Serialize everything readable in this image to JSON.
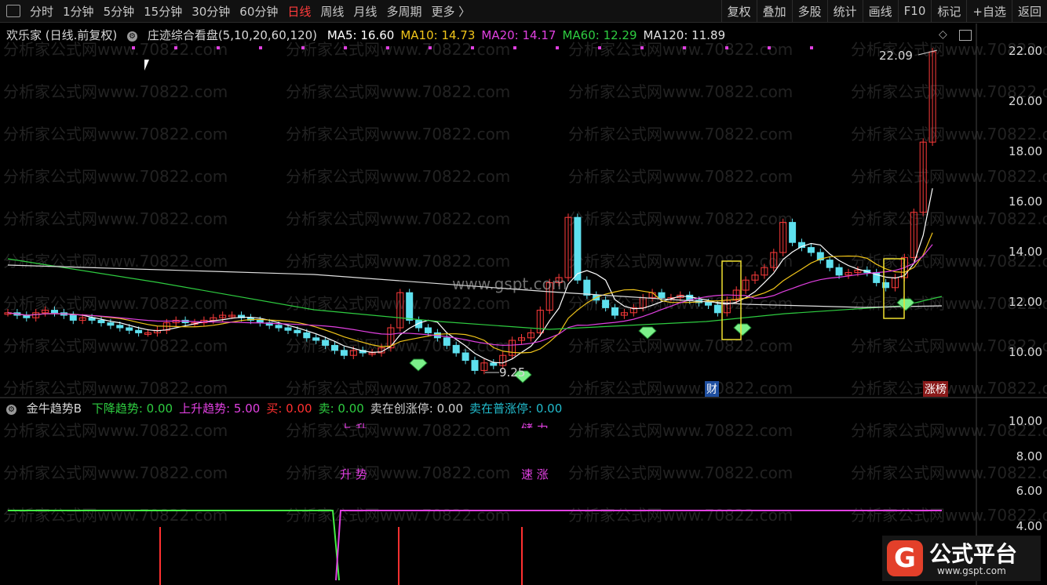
{
  "toolbar": {
    "periods": [
      "分时",
      "1分钟",
      "5分钟",
      "15分钟",
      "30分钟",
      "60分钟",
      "日线",
      "周线",
      "月线",
      "多周期",
      "更多 〉"
    ],
    "active_period": "日线",
    "right_buttons": [
      "复权",
      "叠加",
      "多股",
      "统计",
      "画线",
      "F10",
      "标记",
      "+自选",
      "返回"
    ]
  },
  "main_chart": {
    "title": "欢乐家 (日线.前复权)",
    "indicator_name": "庄迹综合看盘(5,10,20,60,120)",
    "ma": [
      {
        "label": "MA5: 16.60",
        "color": "#ffffff"
      },
      {
        "label": "MA10: 14.73",
        "color": "#f0c419"
      },
      {
        "label": "MA20: 14.17",
        "color": "#e040e0"
      },
      {
        "label": "MA60: 12.29",
        "color": "#2ecc40"
      },
      {
        "label": "MA120: 11.89",
        "color": "#e0e0e0"
      }
    ],
    "price_axis": [
      "22.00",
      "20.00",
      "18.00",
      "16.00",
      "14.00",
      "12.00",
      "10.00"
    ],
    "high_mark": "22.09",
    "low_mark": "9.25",
    "tag_cai": "财",
    "tag_zhangbang": "涨榜"
  },
  "sub_chart": {
    "name": "金牛趋势B",
    "values": [
      {
        "label": "下降趋势: 0.00",
        "color": "#2ecc40"
      },
      {
        "label": "上升趋势: 5.00",
        "color": "#e040e0"
      },
      {
        "label": "买: 0.00",
        "color": "#ff3030"
      },
      {
        "label": "卖: 0.00",
        "color": "#2ecc40"
      },
      {
        "label": "卖在创涨停: 0.00",
        "color": "#d0d0d0"
      },
      {
        "label": "卖在普涨停: 0.00",
        "color": "#22bbcc"
      }
    ],
    "axis": [
      "10.00",
      "8.00",
      "6.00",
      "4.00"
    ],
    "annot_1": "升  势",
    "annot_2": "速  涨",
    "annot_top_1": "上  升",
    "annot_top_2": "储  力"
  },
  "watermark": "分析家公式网www.70822.com",
  "site_watermark": "www.gspt.com",
  "logo": {
    "mark": "G",
    "cn": "公式平台",
    "en": "www.gspt.com"
  }
}
